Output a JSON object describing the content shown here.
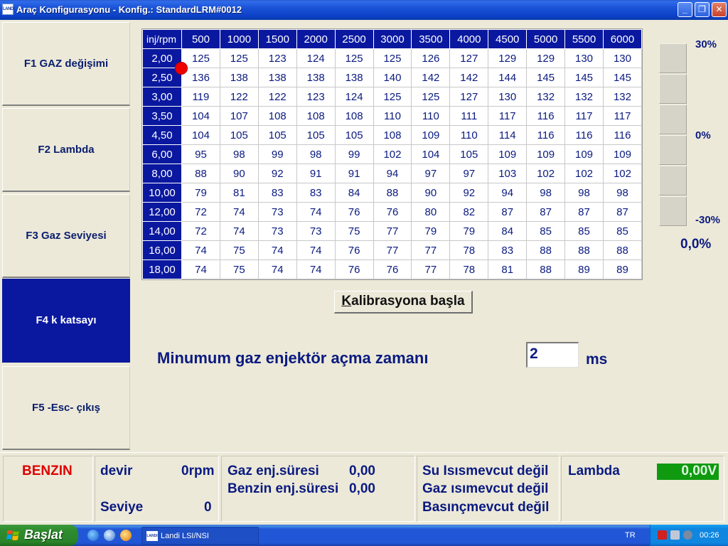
{
  "window": {
    "app_icon": "LANDI",
    "title": "Araç Konfigurasyonu - Konfig.: StandardLRM#0012"
  },
  "sidebar": {
    "items": [
      {
        "label": "F1 GAZ değişimi",
        "active": false
      },
      {
        "label": "F2 Lambda",
        "active": false
      },
      {
        "label": "F3 Gaz Seviyesi",
        "active": false
      },
      {
        "label": "F4 k katsayı",
        "active": true
      },
      {
        "label": "F5 -Esc- çıkış",
        "active": false
      }
    ]
  },
  "grid": {
    "corner_label": "inj/rpm",
    "columns": [
      "500",
      "1000",
      "1500",
      "2000",
      "2500",
      "3000",
      "3500",
      "4000",
      "4500",
      "5000",
      "5500",
      "6000"
    ],
    "rows": [
      {
        "label": "2,00",
        "values": [
          "125",
          "125",
          "123",
          "124",
          "125",
          "125",
          "126",
          "127",
          "129",
          "129",
          "130",
          "130"
        ]
      },
      {
        "label": "2,50",
        "values": [
          "136",
          "138",
          "138",
          "138",
          "138",
          "140",
          "142",
          "142",
          "144",
          "145",
          "145",
          "145"
        ]
      },
      {
        "label": "3,00",
        "values": [
          "119",
          "122",
          "122",
          "123",
          "124",
          "125",
          "125",
          "127",
          "130",
          "132",
          "132",
          "132"
        ]
      },
      {
        "label": "3,50",
        "values": [
          "104",
          "107",
          "108",
          "108",
          "108",
          "110",
          "110",
          "111",
          "117",
          "116",
          "117",
          "117"
        ]
      },
      {
        "label": "4,50",
        "values": [
          "104",
          "105",
          "105",
          "105",
          "105",
          "108",
          "109",
          "110",
          "114",
          "116",
          "116",
          "116"
        ]
      },
      {
        "label": "6,00",
        "values": [
          "95",
          "98",
          "99",
          "98",
          "99",
          "102",
          "104",
          "105",
          "109",
          "109",
          "109",
          "109"
        ]
      },
      {
        "label": "8,00",
        "values": [
          "88",
          "90",
          "92",
          "91",
          "91",
          "94",
          "97",
          "97",
          "103",
          "102",
          "102",
          "102"
        ]
      },
      {
        "label": "10,00",
        "values": [
          "79",
          "81",
          "83",
          "83",
          "84",
          "88",
          "90",
          "92",
          "94",
          "98",
          "98",
          "98"
        ]
      },
      {
        "label": "12,00",
        "values": [
          "72",
          "74",
          "73",
          "74",
          "76",
          "76",
          "80",
          "82",
          "87",
          "87",
          "87",
          "87"
        ]
      },
      {
        "label": "14,00",
        "values": [
          "72",
          "74",
          "73",
          "73",
          "75",
          "77",
          "79",
          "79",
          "84",
          "85",
          "85",
          "85"
        ]
      },
      {
        "label": "16,00",
        "values": [
          "74",
          "75",
          "74",
          "74",
          "76",
          "77",
          "77",
          "78",
          "83",
          "88",
          "88",
          "88"
        ]
      },
      {
        "label": "18,00",
        "values": [
          "74",
          "75",
          "74",
          "74",
          "76",
          "76",
          "77",
          "78",
          "81",
          "88",
          "89",
          "89"
        ]
      }
    ]
  },
  "gauge": {
    "top_label": "30%",
    "mid_label": "0%",
    "bottom_label": "-30%",
    "value": "0,0%"
  },
  "calibration": {
    "button_accel": "K",
    "button_rest": "alibrasyona başla"
  },
  "min_injector": {
    "label": "Minumum gaz enjektör açma zamanı",
    "value": "2",
    "unit": "ms"
  },
  "status": {
    "fuel": "BENZIN",
    "rpm_label": "devir",
    "rpm_value": "0rpm",
    "level_label": "Seviye",
    "level_value": "0",
    "gas_inj_label": "Gaz enj.süresi",
    "gas_inj_value": "0,00",
    "petrol_inj_label": "Benzin enj.süresi",
    "petrol_inj_value": "0,00",
    "water_temp": "Su Isısmevcut değil",
    "gas_temp": "Gaz ısımevcut değil",
    "pressure": "Basınçmevcut değil",
    "lambda_label": "Lambda",
    "lambda_value": "0,00V"
  },
  "taskbar": {
    "start_label": "Başlat",
    "task_label": "Landi LSI/NSI",
    "task_icon": "LANDI",
    "language": "TR",
    "clock": "00:26"
  },
  "colors": {
    "header_blue": "#0a18a0",
    "text_blue": "#0a1a80",
    "fuel_red": "#e00000",
    "lambda_green": "#109a10"
  }
}
